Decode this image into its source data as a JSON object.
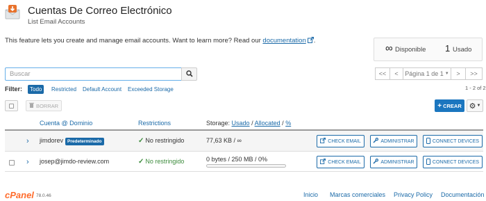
{
  "header": {
    "title": "Cuentas De Correo Electrónico",
    "subtitle": "List Email Accounts"
  },
  "intro": {
    "text": "This feature lets you create and manage email accounts. Want to learn more? Read our ",
    "link": "documentation",
    "end": "."
  },
  "stats": {
    "available_symbol": "∞",
    "available_label": "Disponible",
    "used_value": "1",
    "used_label": "Usado"
  },
  "search": {
    "placeholder": "Buscar"
  },
  "pagination": {
    "first": "<<",
    "prev": "<",
    "page": "Página 1 de 1",
    "next": ">",
    "last": ">>"
  },
  "filter": {
    "label": "Filter:",
    "options": [
      "Todo",
      "Restricted",
      "Default Account",
      "Exceeded Storage"
    ],
    "active": "Todo"
  },
  "count_text": "1 - 2 of 2",
  "toolbar": {
    "delete_label": "BORRAR",
    "create_label": "CREAR"
  },
  "table": {
    "col_account": "Cuenta",
    "col_account_sort": "@ Dominio",
    "col_restrictions": "Restrictions",
    "col_storage_prefix": "Storage:",
    "col_storage_used": "Usado",
    "col_storage_sep1": "/",
    "col_storage_alloc": "Allocated",
    "col_storage_sep2": "/",
    "col_storage_pct": "%",
    "rows": [
      {
        "account": "jimdorev",
        "badge": "Predeterminado",
        "restriction": "No restringido",
        "storage": "77,63 KB / ∞",
        "btn_check": "CHECK EMAIL",
        "btn_admin": "ADMINISTRAR",
        "btn_connect": "CONNECT DEVICES"
      },
      {
        "account": "josep@jimdo-review.com",
        "restriction": "No restringido",
        "storage": "0 bytes / 250 MB / 0%",
        "usage_percent": 0,
        "btn_check": "CHECK EMAIL",
        "btn_admin": "ADMINISTRAR",
        "btn_connect": "CONNECT DEVICES"
      }
    ]
  },
  "footer": {
    "logo": "cPanel",
    "version": "78.0.46",
    "links": [
      "Inicio",
      "Marcas comerciales",
      "Privacy Policy",
      "Documentación"
    ]
  },
  "colors": {
    "link": "#1b6aa8",
    "primary_button": "#1b76bf",
    "success": "#3c8b3c",
    "cpanel_brand": "#ff6c2c",
    "header_icon": "#e8722c"
  }
}
